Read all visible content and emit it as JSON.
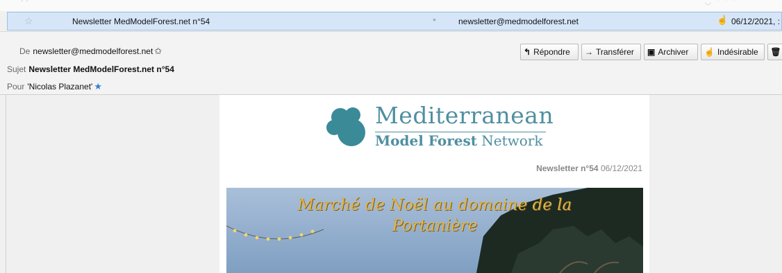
{
  "message_row": {
    "subject": "Newsletter MedModelForest.net n°54",
    "from": "newsletter@medmodelforest.net",
    "date": "06/12/2021, :"
  },
  "header": {
    "from_label": "De",
    "from_value": "newsletter@medmodelforest.net",
    "subject_label": "Sujet",
    "subject_value": "Newsletter MedModelForest.net n°54",
    "to_label": "Pour",
    "to_value": "'Nicolas Plazanet'"
  },
  "toolbar": {
    "reply": "Répondre",
    "forward": "Transférer",
    "archive": "Archiver",
    "junk": "Indésirable"
  },
  "newsletter": {
    "logo_line1": "Mediterranean",
    "logo_line2_bold": "Model Forest",
    "logo_line2_rest": " Network",
    "issue_label": "Newsletter n°54",
    "issue_date": "06/12/2021",
    "banner_line1": "Marché de Noël au domaine de la",
    "banner_line2": "Portanière"
  },
  "colors": {
    "selection": "#d6e6f8",
    "logo": "#4f8fa0",
    "banner_text": "#e0b44a"
  },
  "icons": [
    "star-icon",
    "unread-dot-icon",
    "junk-hand-icon",
    "reply-icon",
    "forward-icon",
    "archive-icon",
    "trash-icon"
  ]
}
